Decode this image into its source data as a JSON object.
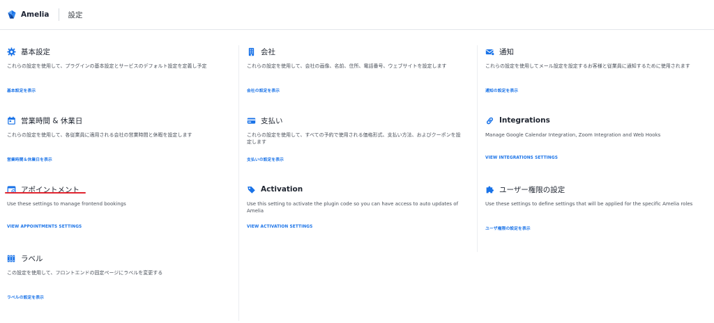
{
  "header": {
    "brand": "Amelia",
    "title": "設定"
  },
  "colors": {
    "accent": "#1a73e8",
    "icon_blue": "#1a73e8",
    "highlight_red": "#e0242e"
  },
  "cards": [
    {
      "icon": "gear-icon",
      "title": "基本設定",
      "desc": "これらの設定を使用して、プラグインの基本設定とサービスのデフォルト設定を定義し予定",
      "link": "基本設定を表示"
    },
    {
      "icon": "building-icon",
      "title": "会社",
      "desc": "これらの設定を使用して、会社の画像、名前、住所、電話番号、ウェブサイトを設定します",
      "link": "会社の設定を表示"
    },
    {
      "icon": "envelope-icon",
      "title": "通知",
      "desc": "これらの設定を使用してメール設定を設定するお客様と従業員に通知するために使用されます",
      "link": "通知の設定を表示"
    },
    {
      "icon": "calendar-icon",
      "title": "営業時間 & 休業日",
      "desc": "これらの設定を使用して、各従業員に適用される会社の営業時間と休暇を設定します",
      "link": "営業時間＆休業日を表示"
    },
    {
      "icon": "credit-card-icon",
      "title": "支払い",
      "desc": "これらの設定を使用して、すべての予約で使用される価格形式、支払い方法、およびクーポンを設定します",
      "link": "支払いの設定を表示"
    },
    {
      "icon": "link-icon",
      "title": "Integrations",
      "desc": "Manage Google Calendar Integration, Zoom Integration and Web Hooks",
      "link": "VIEW INTEGRATIONS SETTINGS"
    },
    {
      "icon": "calendar-check-icon",
      "title": "アポイントメント",
      "desc": "Use these settings to manage frontend bookings",
      "link": "VIEW APPOINTMENTS SETTINGS"
    },
    {
      "icon": "tag-icon",
      "title": "Activation",
      "desc": "Use this setting to activate the plugin code so you can have access to auto updates of Amelia",
      "link": "VIEW ACTIVATION SETTINGS"
    },
    {
      "icon": "puzzle-icon",
      "title": "ユーザー権限の設定",
      "desc": "Use these settings to define settings that will be applied for the specific Amelia roles",
      "link": "ユーザ権限の設定を表示"
    },
    {
      "icon": "books-icon",
      "title": "ラベル",
      "desc": "この設定を使用して、フロントエンドの固定ページにラベルを変更する",
      "link": "ラベルの設定を表示"
    }
  ]
}
